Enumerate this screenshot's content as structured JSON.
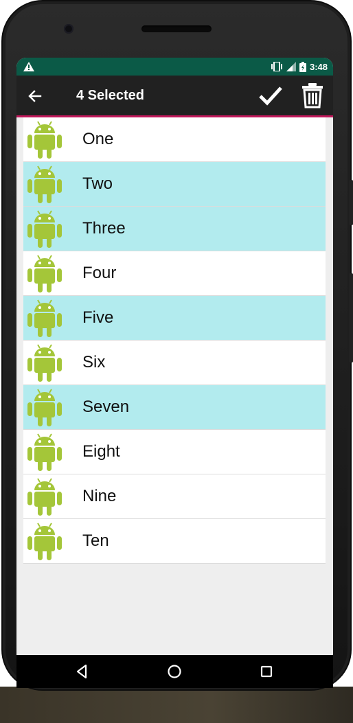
{
  "status_bar": {
    "time": "3:48",
    "icons": [
      "warning-icon",
      "vibrate-icon",
      "signal-icon",
      "battery-icon"
    ]
  },
  "toolbar": {
    "title": "4 Selected",
    "back_icon": "arrow-back-icon",
    "confirm_icon": "check-icon",
    "delete_icon": "trash-icon"
  },
  "list": {
    "items": [
      {
        "label": "One",
        "selected": false
      },
      {
        "label": "Two",
        "selected": true
      },
      {
        "label": "Three",
        "selected": true
      },
      {
        "label": "Four",
        "selected": false
      },
      {
        "label": "Five",
        "selected": true
      },
      {
        "label": "Six",
        "selected": false
      },
      {
        "label": "Seven",
        "selected": true
      },
      {
        "label": "Eight",
        "selected": false
      },
      {
        "label": "Nine",
        "selected": false
      },
      {
        "label": "Ten",
        "selected": false
      }
    ],
    "item_icon": "android-robot-icon"
  },
  "nav_bar": {
    "icons": [
      "back-triangle-icon",
      "home-circle-icon",
      "recents-square-icon"
    ]
  },
  "colors": {
    "status_bar": "#0b5a47",
    "toolbar": "#212121",
    "toolbar_accent": "#c2185b",
    "selected_row": "#b2ebee",
    "android_green": "#a4c639"
  }
}
